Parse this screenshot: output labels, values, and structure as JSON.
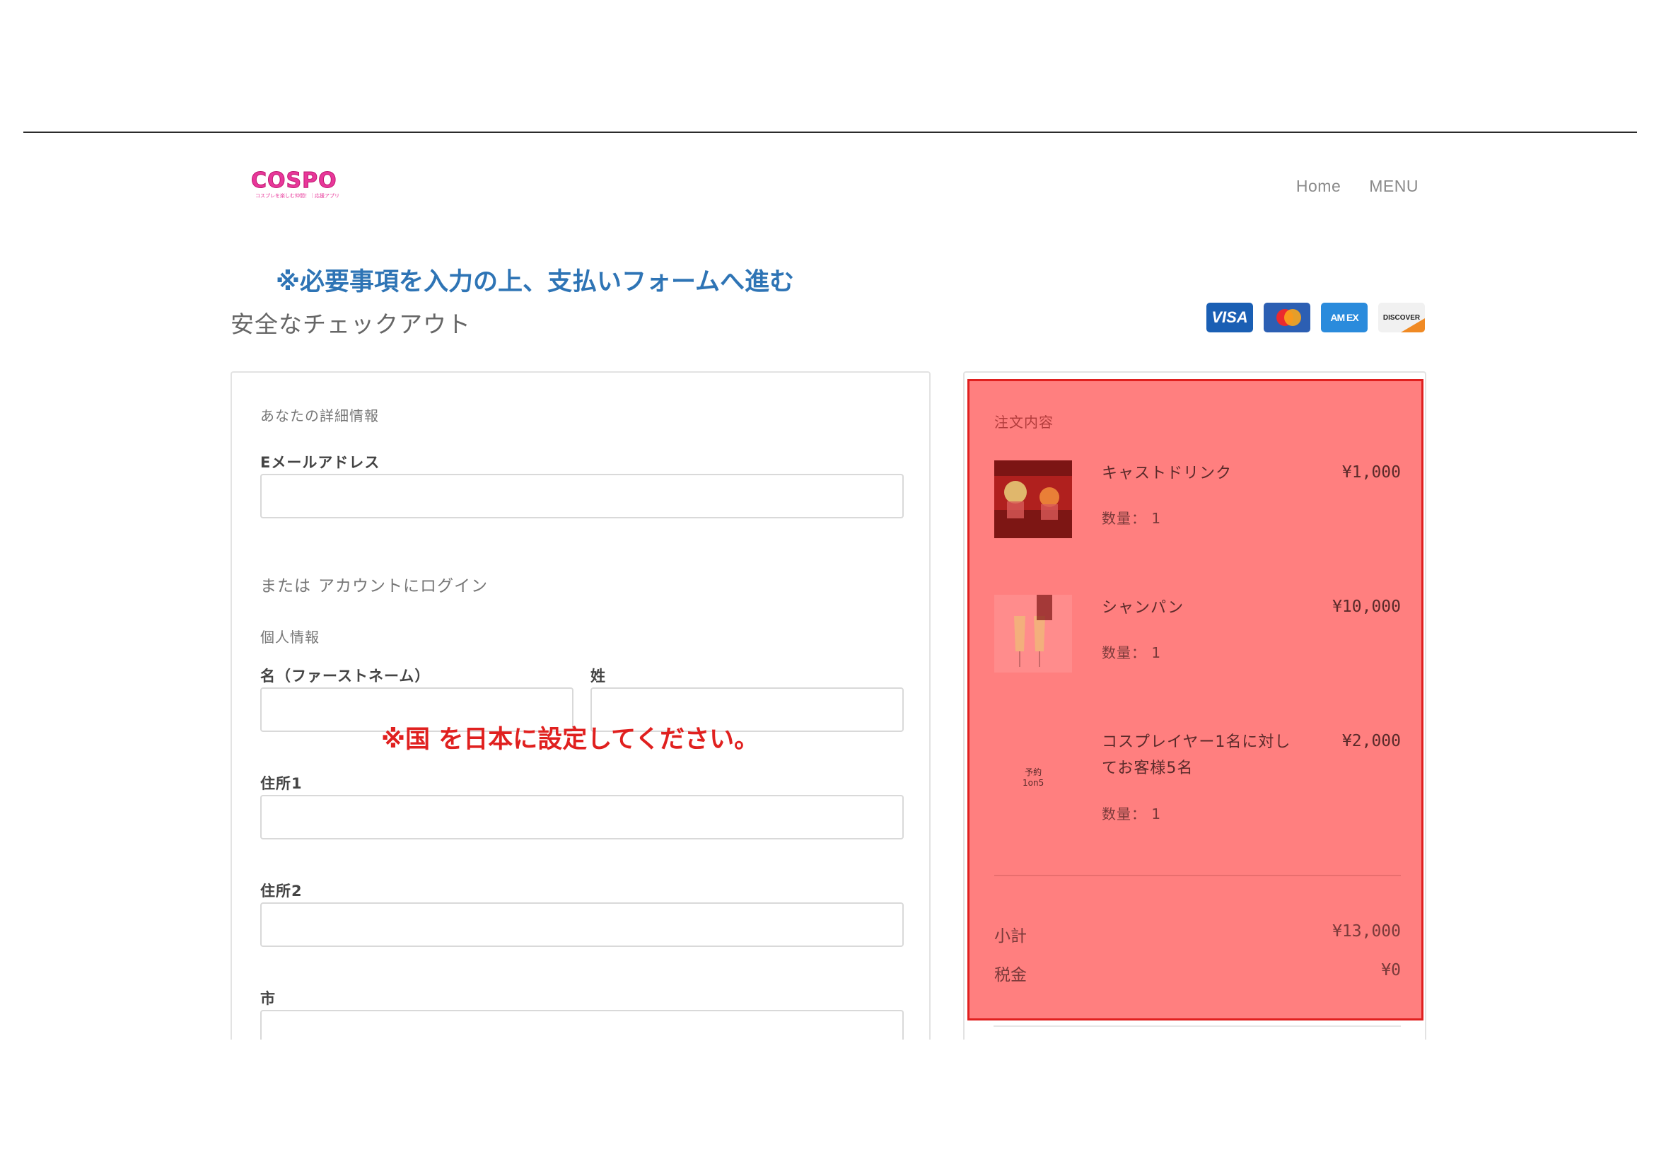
{
  "header": {
    "logo_text": "COSPO",
    "logo_tagline": "コスプレを楽しむ仲間！｜応援アプリ",
    "nav": [
      "Home",
      "MENU"
    ]
  },
  "notices": {
    "blue": "※必要事項を入力の上、支払いフォームへ進む",
    "red": "※国 を日本に設定してください。"
  },
  "checkout_title": "安全なチェックアウト",
  "payment_cards": [
    {
      "name": "VISA",
      "icon": "visa-card-icon"
    },
    {
      "name": "Mastercard",
      "icon": "mastercard-icon"
    },
    {
      "name": "AMEX",
      "icon": "amex-card-icon"
    },
    {
      "name": "DISCOVER",
      "icon": "discover-card-icon"
    }
  ],
  "form": {
    "details_heading": "あなたの詳細情報",
    "email_label": "Eメールアドレス",
    "email_value": "",
    "login_prefix": "または",
    "login_link": "アカウントにログイン",
    "personal_heading": "個人情報",
    "first_name_label": "名（ファーストネーム）",
    "first_name_value": "",
    "last_name_label": "姓",
    "last_name_value": "",
    "address1_label": "住所1",
    "address1_value": "",
    "address2_label": "住所2",
    "address2_value": "",
    "city_label": "市",
    "city_value": ""
  },
  "order": {
    "heading": "注文内容",
    "items": [
      {
        "name": "キャストドリンク",
        "price": "¥1,000",
        "qty_label": "数量：",
        "qty": "1"
      },
      {
        "name": "シャンパン",
        "price": "¥10,000",
        "qty_label": "数量：",
        "qty": "1"
      },
      {
        "name": "コスプレイヤー1名に対してお客様5名",
        "price": "¥2,000",
        "qty_label": "数量：",
        "qty": "1",
        "thumb_text_1": "予約",
        "thumb_text_2": "1on5"
      }
    ],
    "subtotal_label": "小計",
    "subtotal_value": "¥13,000",
    "tax_label": "税金",
    "tax_value": "¥0"
  },
  "colors": {
    "highlight_fill": "#ff7f7f",
    "highlight_border": "#e0201f",
    "notice_blue": "#2e74b5",
    "notice_red": "#e0201f",
    "brand_pink": "#e8379a"
  }
}
